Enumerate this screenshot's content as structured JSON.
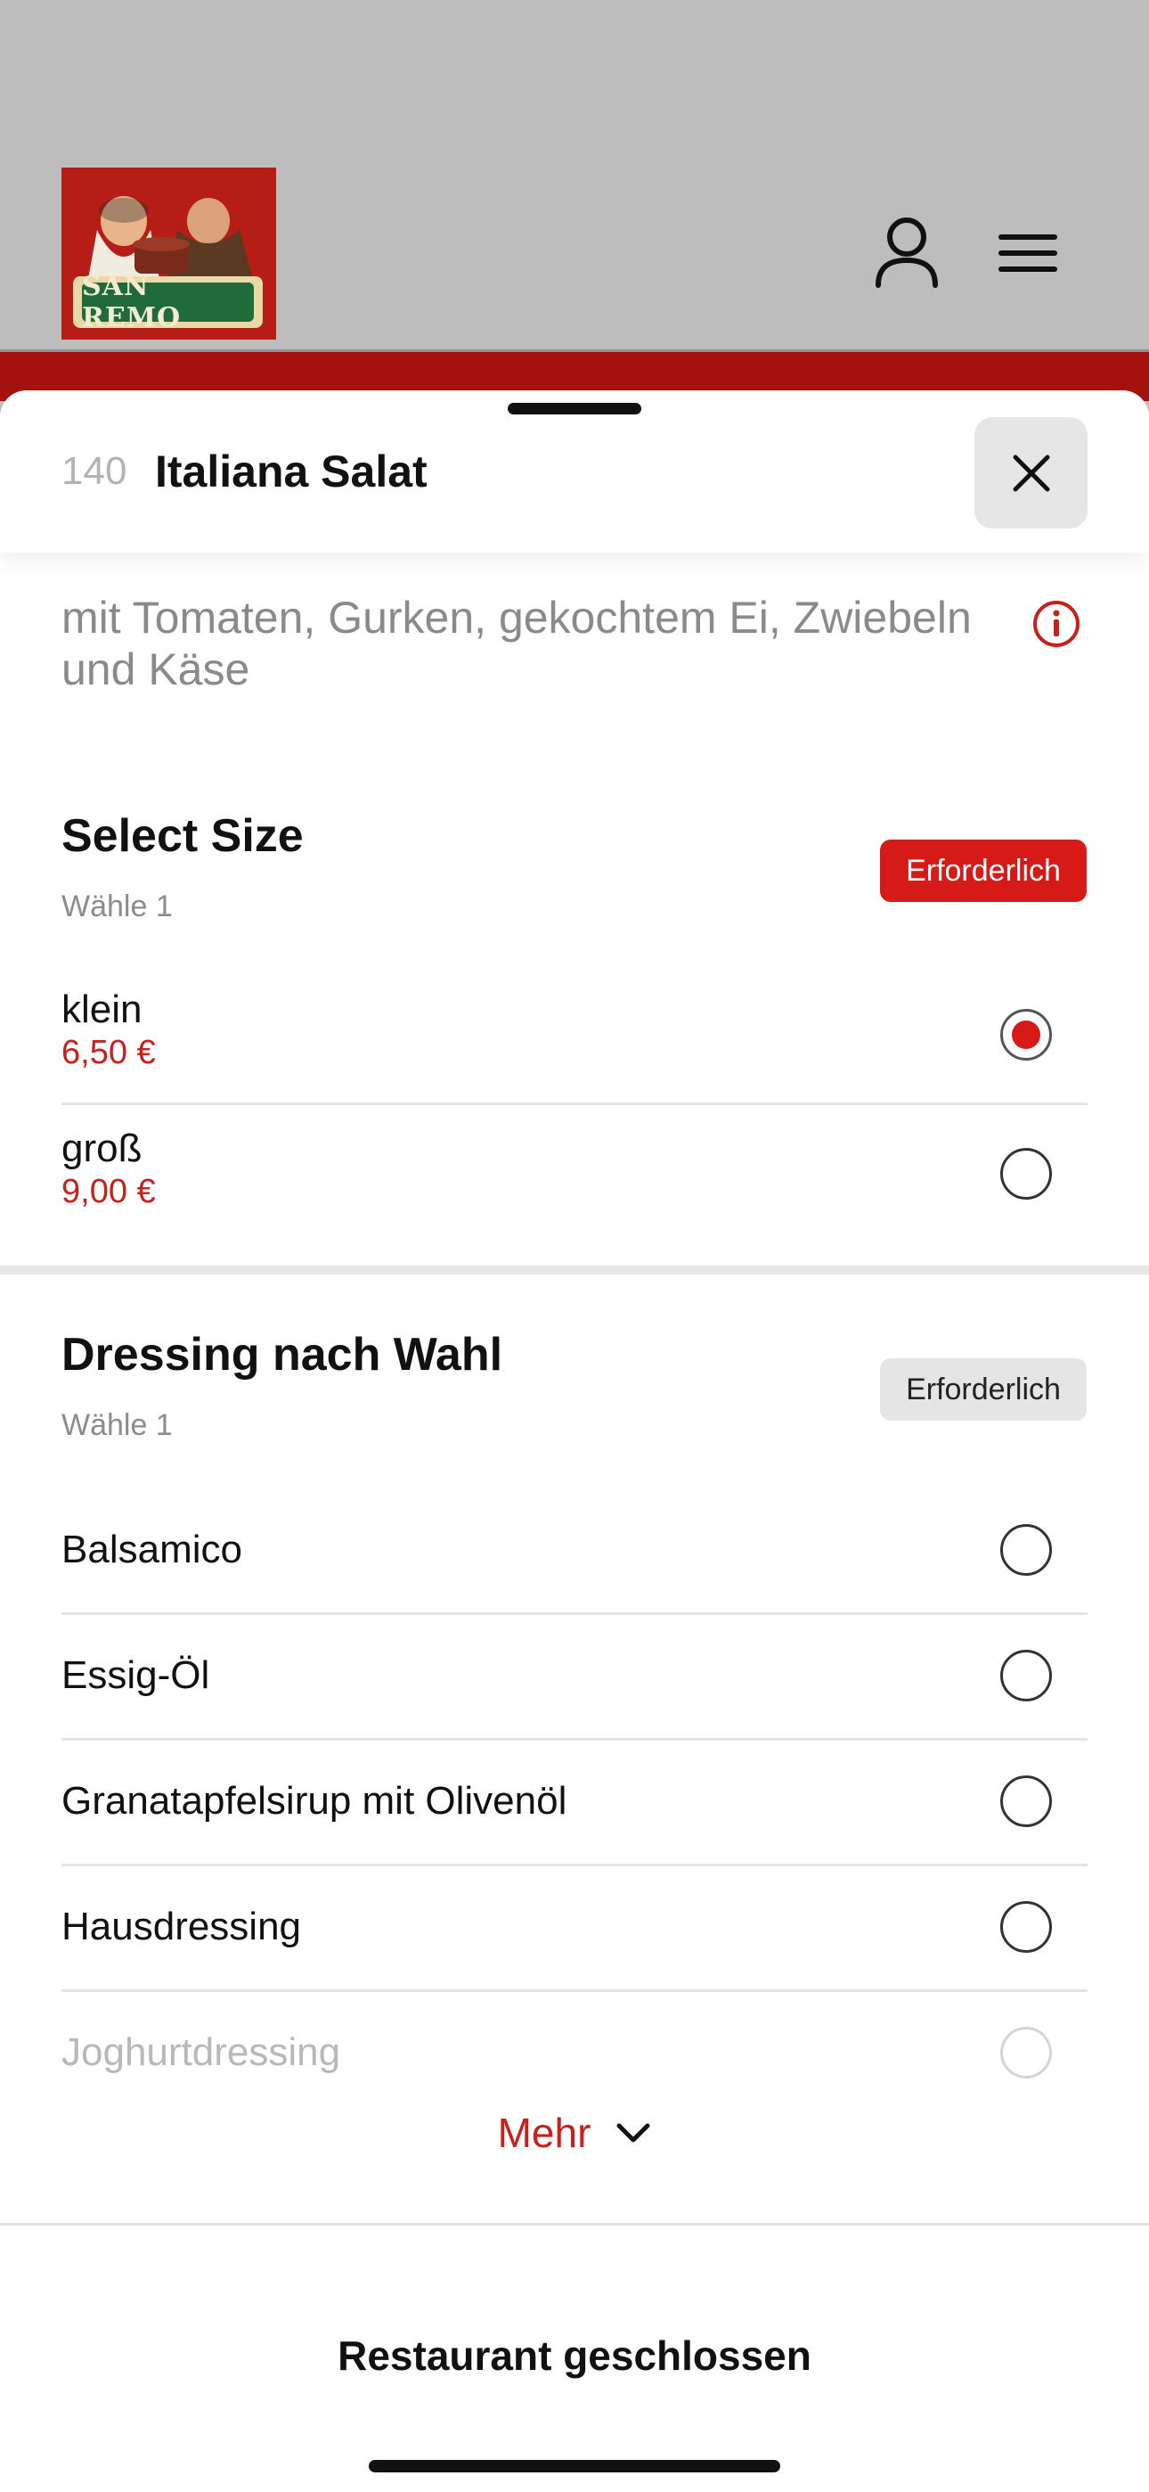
{
  "header": {
    "logo_text": "SAN REMO",
    "user_icon": "user-icon",
    "menu_icon": "menu-icon"
  },
  "item": {
    "number": "140",
    "title": "Italiana Salat",
    "description": "mit Tomaten, Gurken, gekochtem Ei, Zwiebeln und Käse",
    "close_icon": "close-icon",
    "info_icon": "info-icon"
  },
  "size_section": {
    "title": "Select Size",
    "subtitle": "Wähle 1",
    "badge": "Erforderlich",
    "options": [
      {
        "label": "klein",
        "price": "6,50 €",
        "selected": true
      },
      {
        "label": "groß",
        "price": "9,00 €",
        "selected": false
      }
    ]
  },
  "dressing_section": {
    "title": "Dressing nach Wahl",
    "subtitle": "Wähle 1",
    "badge": "Erforderlich",
    "options": [
      {
        "label": "Balsamico",
        "selected": false
      },
      {
        "label": "Essig-Öl",
        "selected": false
      },
      {
        "label": "Granatapfelsirup mit Olivenöl",
        "selected": false
      },
      {
        "label": "Hausdressing",
        "selected": false
      },
      {
        "label": "Joghurtdressing",
        "selected": false
      }
    ],
    "more_label": "Mehr"
  },
  "footer": {
    "status": "Restaurant geschlossen"
  },
  "colors": {
    "brand_red": "#d61a17",
    "price_red": "#c8201b",
    "header_bar": "#a3120f"
  }
}
